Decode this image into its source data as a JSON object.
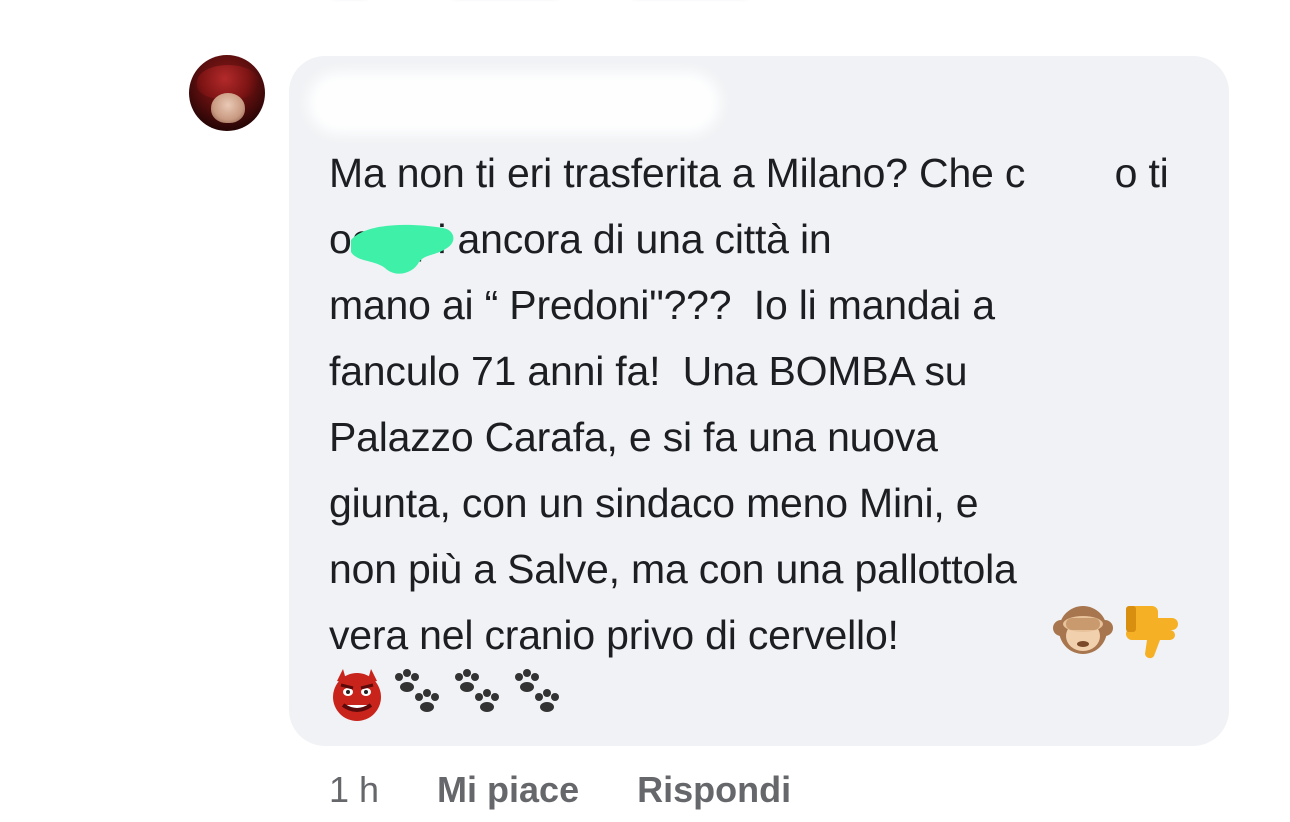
{
  "comment": {
    "author_name": "",
    "text": "Ma non ti eri trasferita a Milano? Che c        o ti occupi ancora di una città in\nmano ai “ Predoni\"???  Io li mandai a\nfanculo 71 anni fa!  Una BOMBA su\nPalazzo Carafa, e si fa una nuova\ngiunta, con un sindaco meno Mini, e\nnon più a Salve, ma con una pallottola\nvera nel cranio privo di cervello!",
    "emojis_line1": [
      "see-no-evil-monkey",
      "thumbs-down"
    ],
    "emojis_line2": [
      "ogre",
      "paw-prints",
      "paw-prints",
      "paw-prints"
    ]
  },
  "actions": {
    "time": "1 h",
    "like": "Mi piace",
    "reply": "Rispondi"
  },
  "colors": {
    "bubble": "#f0f2f5",
    "text": "#1c1e21",
    "meta": "#65676b",
    "redaction": "#3ef0a8"
  }
}
